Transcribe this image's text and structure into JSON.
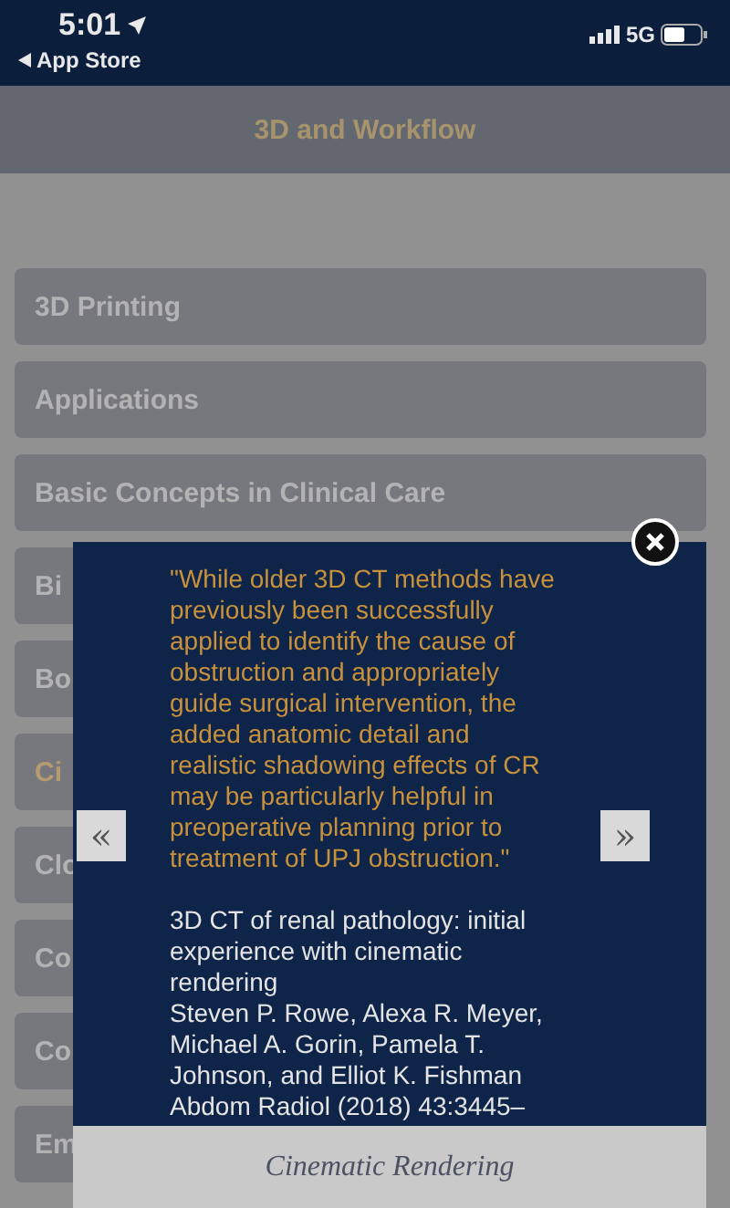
{
  "status_bar": {
    "time": "5:01",
    "back_label": "App Store",
    "network": "5G"
  },
  "header": {
    "title": "3D and Workflow"
  },
  "menu_items": [
    {
      "label": "3D Printing",
      "selected": false
    },
    {
      "label": "Applications",
      "selected": false
    },
    {
      "label": "Basic Concepts in Clinical Care",
      "selected": false
    },
    {
      "label": "Bi",
      "selected": false
    },
    {
      "label": "Bo",
      "selected": false
    },
    {
      "label": "Ci",
      "selected": true
    },
    {
      "label": "Clo",
      "selected": false
    },
    {
      "label": "Co",
      "selected": false
    },
    {
      "label": "Co",
      "selected": false
    },
    {
      "label": "Em",
      "selected": false
    }
  ],
  "modal": {
    "prev_label": "«",
    "next_label": "»",
    "quote": "\"While older 3D CT methods have previously been successfully applied to identify the cause of obstruction and appropriately guide surgical intervention, the added anatomic detail and realistic shadowing effects of CR may be particularly helpful in preoperative planning prior to treatment of UPJ obstruction.\"",
    "citation": [
      "3D CT of renal pathology: initial experience with cinematic rendering",
      "Steven P. Rowe, Alexa R. Meyer, Michael A. Gorin, Pamela T. Johnson, and Elliot K. Fishman",
      "Abdom Radiol (2018) 43:3445–"
    ],
    "caption": "Cinematic Rendering"
  }
}
